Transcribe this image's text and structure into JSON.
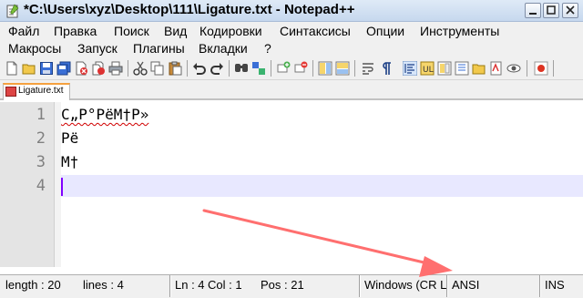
{
  "window": {
    "title": "*C:\\Users\\xyz\\Desktop\\111\\Ligature.txt - Notepad++",
    "icon": "notepad-plus-plus-icon"
  },
  "menu": [
    {
      "label": "Файл"
    },
    {
      "label": "Правка"
    },
    {
      "label": "Поиск"
    },
    {
      "label": "Вид"
    },
    {
      "label": "Кодировки"
    },
    {
      "label": "Синтаксисы"
    },
    {
      "label": "Опции"
    },
    {
      "label": "Инструменты"
    },
    {
      "label": "Макросы"
    },
    {
      "label": "Запуск"
    },
    {
      "label": "Плагины"
    },
    {
      "label": "Вкладки"
    },
    {
      "label": "?"
    }
  ],
  "toolbar_icons": [
    "new-file-icon",
    "open-file-icon",
    "save-icon",
    "save-all-icon",
    "close-icon",
    "close-all-icon",
    "print-icon",
    "cut-icon",
    "copy-icon",
    "paste-icon",
    "undo-icon",
    "redo-icon",
    "find-icon",
    "replace-icon",
    "zoom-in-icon",
    "zoom-out-icon",
    "sync-vertical-icon",
    "sync-horizontal-icon",
    "word-wrap-icon",
    "show-all-chars-icon",
    "indent-guide-icon",
    "user-language-icon",
    "doc-map-icon",
    "function-list-icon",
    "folder-workspace-icon",
    "monitoring-icon",
    "record-macro-icon"
  ],
  "tabs": [
    {
      "label": "Ligature.txt",
      "active": true
    }
  ],
  "editor": {
    "lines": [
      {
        "number": "1",
        "text": "С„Р°РёМ†Р»"
      },
      {
        "number": "2",
        "text": "Рё"
      },
      {
        "number": "3",
        "text": "М†"
      },
      {
        "number": "4",
        "text": ""
      }
    ],
    "current_line_color": "#e8e8ff",
    "caret_color": "#8000ff"
  },
  "status_bar": {
    "length": "length : 20",
    "lines": "lines : 4",
    "ln": "Ln : 4",
    "col": "Col : 1",
    "pos": "Pos : 21",
    "eol": "Windows (CR LF)",
    "encoding": "ANSI",
    "mode": "INS"
  },
  "annotation": {
    "arrow_color": "#ff6f6f"
  }
}
